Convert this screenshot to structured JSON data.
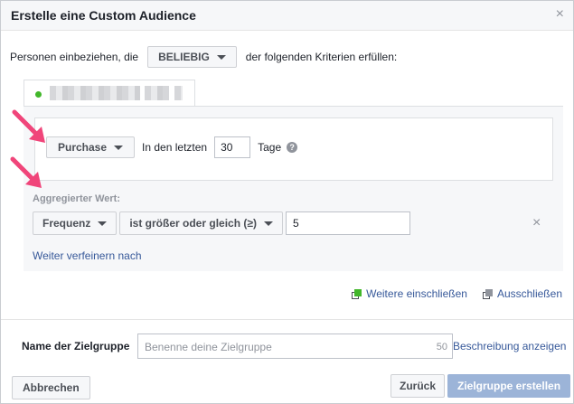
{
  "dialog": {
    "title": "Erstelle eine Custom Audience",
    "close_glyph": "×"
  },
  "include_row": {
    "prefix": "Personen einbeziehen, die",
    "mode": "BELIEBIG",
    "suffix": "der folgenden Kriterien erfüllen:"
  },
  "event_rule": {
    "event": "Purchase",
    "period_label": "In den letzten",
    "days": "30",
    "days_unit": "Tage",
    "info_glyph": "?"
  },
  "aggregated": {
    "label": "Aggregierter Wert:",
    "metric": "Frequenz",
    "operator": "ist größer oder gleich (≥)",
    "value": "5",
    "remove_glyph": "×",
    "refine_link": "Weiter verfeinern nach"
  },
  "links": {
    "include_more": "Weitere einschließen",
    "exclude": "Ausschließen"
  },
  "audience_name": {
    "label": "Name der Zielgruppe",
    "placeholder": "Benenne deine Zielgruppe",
    "char_count": "50",
    "description_link": "Beschreibung anzeigen"
  },
  "footer": {
    "cancel": "Abbrechen",
    "back": "Zurück",
    "create": "Zielgruppe erstellen"
  },
  "colors": {
    "link": "#365899",
    "primary_disabled": "#9cb4d8",
    "annotation_arrow": "#f0457a",
    "source_dot": "#42b72a"
  }
}
